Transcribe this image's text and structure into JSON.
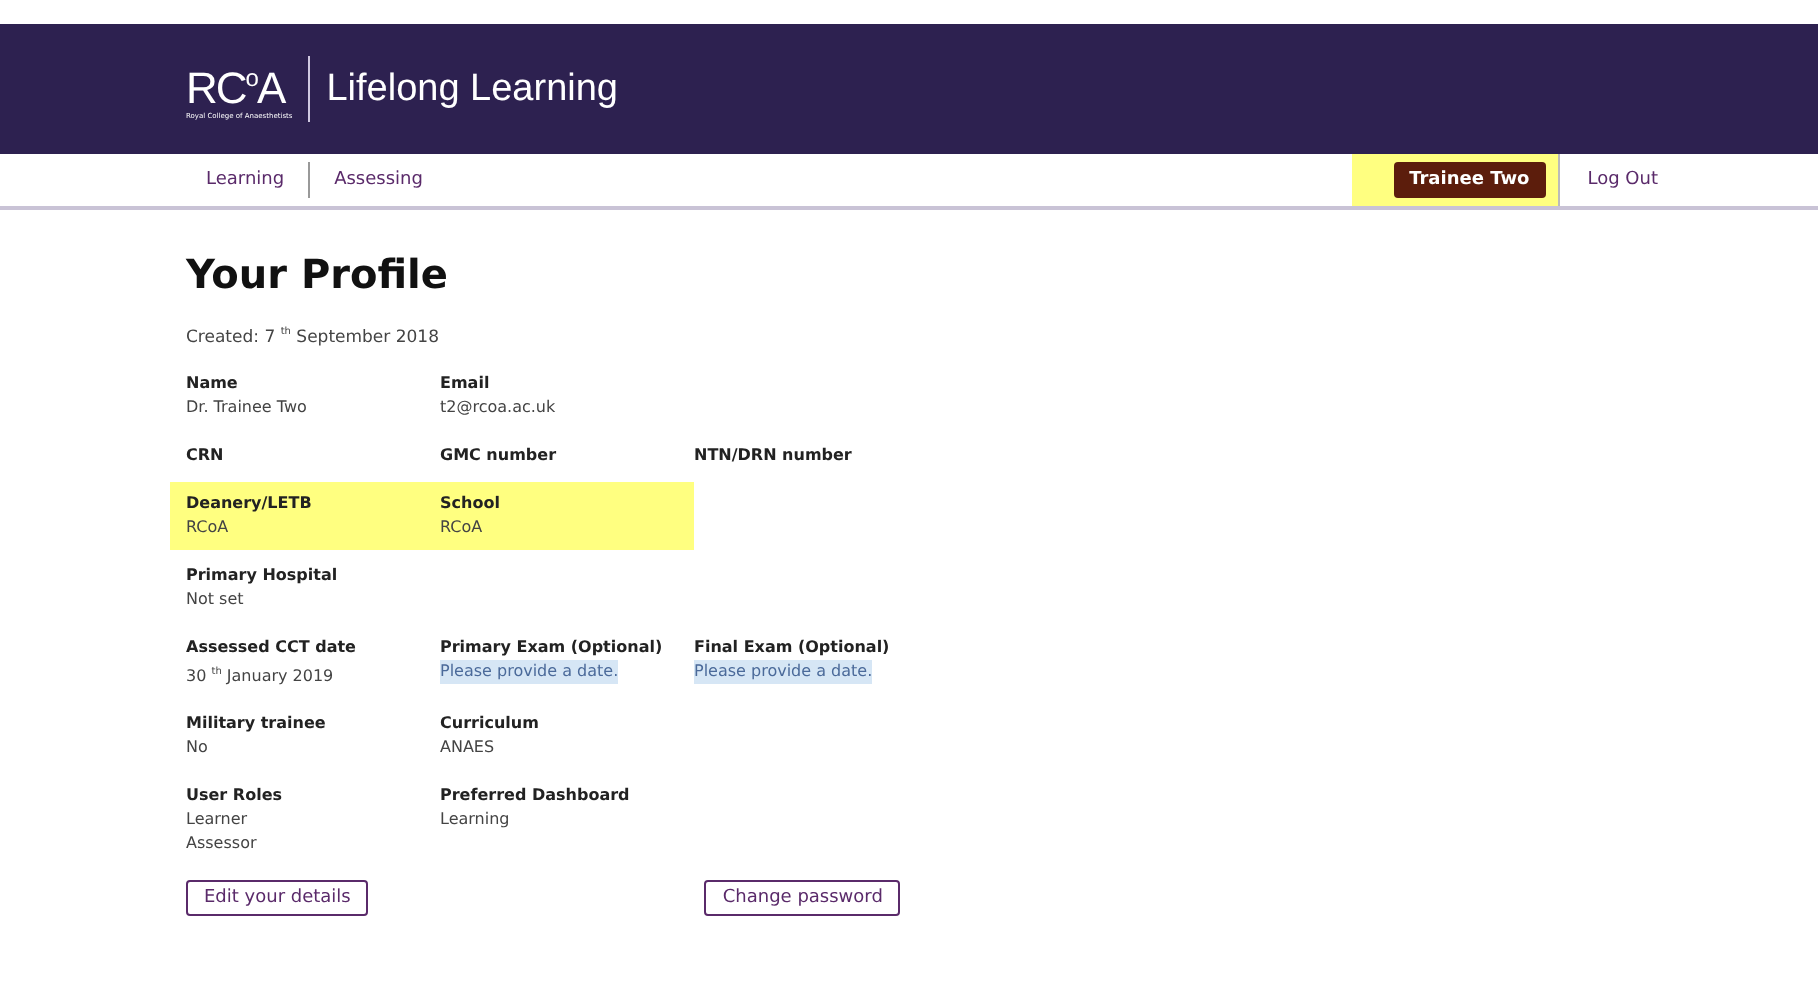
{
  "header": {
    "logo": "RC$^{o}$A",
    "logo_subtitle": "Royal College of Anaesthetists",
    "title": "Lifelong Learning"
  },
  "nav": {
    "items": [
      {
        "label": "Learning"
      },
      {
        "label": "Assessing"
      }
    ],
    "user": {
      "label": "Trainee Two",
      "highlighted": true
    },
    "logout": "Log Out"
  },
  "profile": {
    "title": "Your Profile",
    "created": "Created: 7 $^{th}$ September 2018",
    "rows": [
      [
        {
          "label": "Name",
          "values": [
            "Dr. Trainee Two"
          ]
        },
        {
          "label": "Email",
          "values": [
            "t2@rcoa.ac.uk"
          ]
        }
      ],
      [
        {
          "label": "CRN"
        },
        {
          "label": "GMC number"
        },
        {
          "label": "NTN/DRN number"
        }
      ],
      [
        {
          "label": "Deanery/LETB",
          "values": [
            "RCoA"
          ],
          "highlighted": true
        },
        {
          "label": "School",
          "values": [
            "RCoA"
          ],
          "highlighted": true
        }
      ],
      [
        {
          "label": "Primary Hospital",
          "values": [
            "Not set"
          ]
        }
      ],
      [
        {
          "label": "Assessed CCT date",
          "values": [
            "30 $^{th}$ January 2019"
          ]
        },
        {
          "label": "Primary Exam (Optional)",
          "values": [
            "Please provide a date."
          ],
          "kind": "prompt"
        },
        {
          "label": "Final Exam (Optional)",
          "values": [
            "Please provide a date."
          ],
          "kind": "prompt"
        }
      ],
      [
        {
          "label": "Military trainee",
          "values": [
            "No"
          ]
        },
        {
          "label": "Curriculum",
          "values": [
            "ANAES"
          ]
        }
      ],
      [
        {
          "label": "User Roles",
          "values": [
            "Learner",
            "Assessor"
          ]
        },
        {
          "label": "Preferred Dashboard",
          "values": [
            "Learning"
          ]
        }
      ]
    ],
    "buttons": [
      "Edit your details",
      "Change password"
    ]
  }
}
